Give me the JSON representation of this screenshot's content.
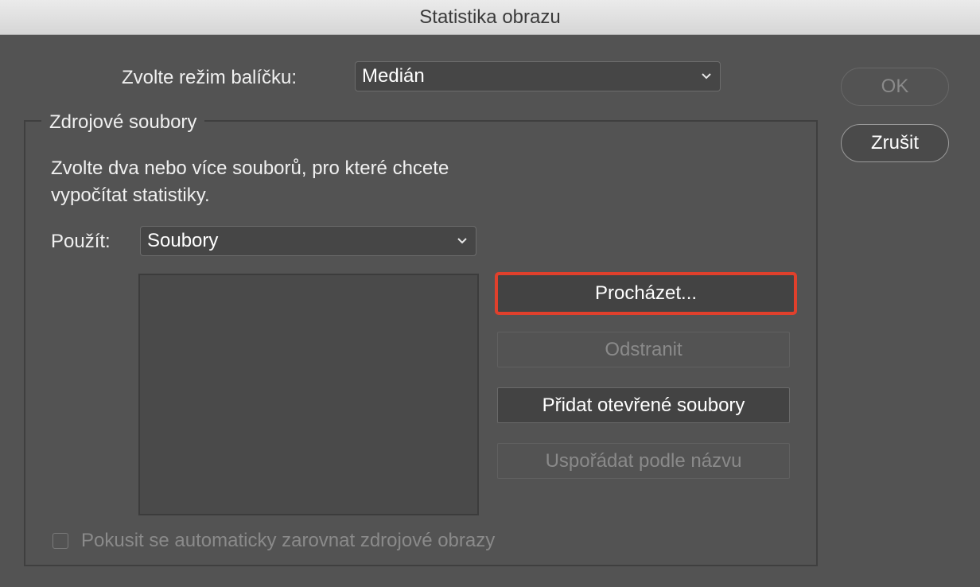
{
  "window": {
    "title": "Statistika obrazu"
  },
  "stack_mode": {
    "label": "Zvolte režim balíčku:",
    "selected": "Medián"
  },
  "source_files": {
    "group_title": "Zdrojové soubory",
    "description_line1": "Zvolte dva nebo více souborů, pro které chcete",
    "description_line2": "vypočítat statistiky.",
    "use_label": "Použít:",
    "use_selected": "Soubory",
    "buttons": {
      "browse": "Procházet...",
      "remove": "Odstranit",
      "add_open": "Přidat otevřené soubory",
      "sort_by_name": "Uspořádat podle názvu"
    },
    "auto_align_checkbox": {
      "label": "Pokusit se automaticky zarovnat zdrojové obrazy",
      "checked": false
    }
  },
  "dialog_buttons": {
    "ok": "OK",
    "cancel": "Zrušit"
  },
  "colors": {
    "background": "#535353",
    "focus_ring": "#e0402c"
  },
  "icons": {
    "select_arrow": "chevron-down-icon"
  }
}
